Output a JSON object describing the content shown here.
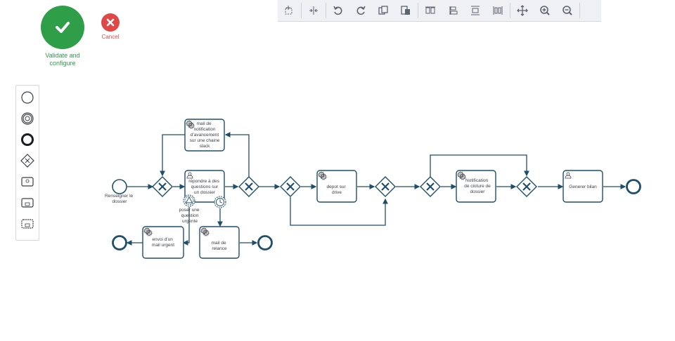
{
  "actions": {
    "validate_label": "Validate and configure",
    "cancel_label": "Cancel"
  },
  "toolbar": {
    "buttons": [
      "select-tool-icon",
      "space-tool-icon",
      "undo-icon",
      "redo-icon",
      "copy-icon",
      "paste-icon",
      "align-icon",
      "distribute-vertical-icon",
      "distribute-horizontal-icon",
      "align-center-icon",
      "fit-view-icon",
      "zoom-in-icon",
      "zoom-out-icon"
    ]
  },
  "palette": {
    "items": [
      "start-event-icon",
      "intermediate-event-icon",
      "end-event-icon",
      "gateway-icon",
      "task-icon",
      "subprocess-icon",
      "collapsed-subprocess-icon"
    ]
  },
  "diagram": {
    "start_event_label": "Renseigner le dossier",
    "tasks": {
      "mail_slack": "mail de notification d'avancement sur une chaine slack",
      "repondre": "répondre à des questions sur un dossier",
      "mail_urgent": "envoi d'un mail urgent",
      "relance": "mail de relance",
      "depot": "depot sur drive",
      "notif_cloture": "Notification de cloture de dossier",
      "bilan": "Generer bilan"
    },
    "boundary_label": "poser une question urgente"
  },
  "colors": {
    "stroke": "#1f4e6b",
    "green": "#2e9e48",
    "red": "#e04848"
  }
}
